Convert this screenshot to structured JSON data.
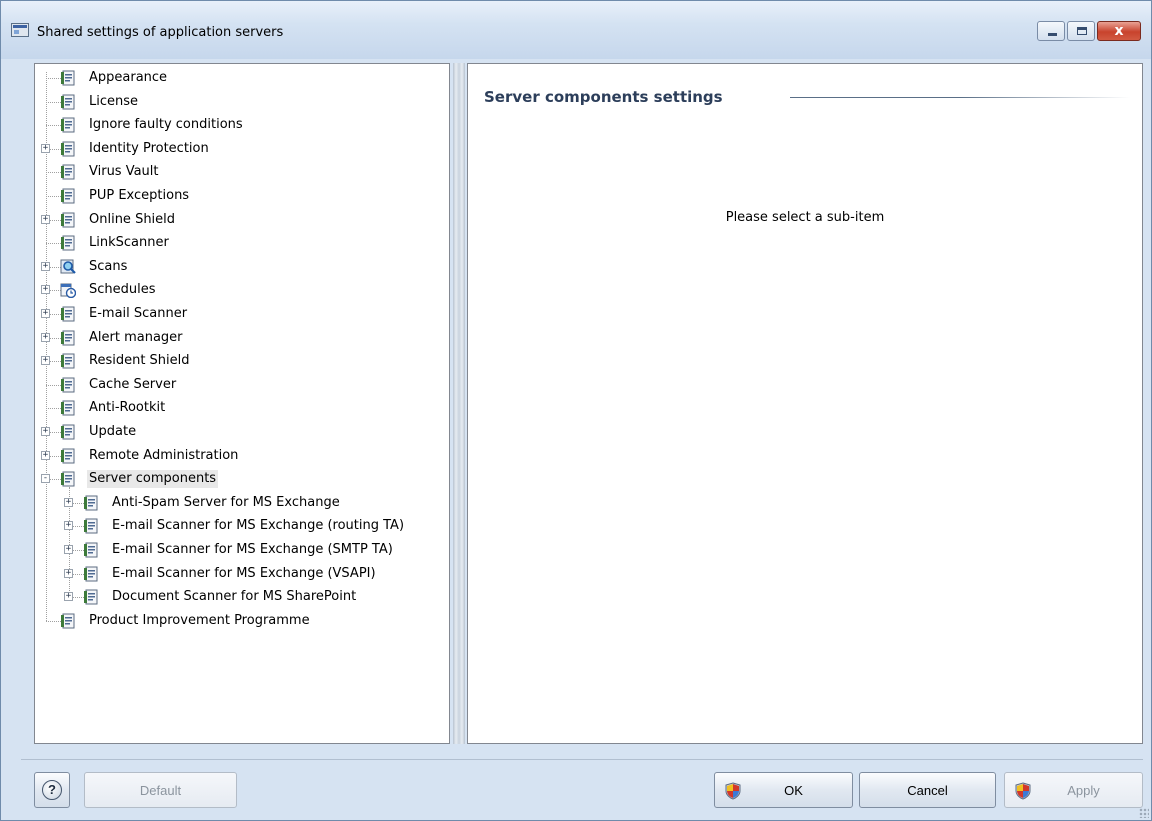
{
  "window": {
    "title": "Shared settings of application servers",
    "close_glyph": "x",
    "minimize_icon": "minimize-icon",
    "maximize_icon": "maximize-icon",
    "close_icon": "close-icon"
  },
  "tree": {
    "items": [
      {
        "label": "Appearance",
        "icon": "settings-page-icon",
        "expander": "",
        "level": 0
      },
      {
        "label": "License",
        "icon": "settings-page-icon",
        "expander": "",
        "level": 0
      },
      {
        "label": "Ignore faulty conditions",
        "icon": "settings-page-icon",
        "expander": "",
        "level": 0
      },
      {
        "label": "Identity Protection",
        "icon": "settings-page-icon",
        "expander": "+",
        "level": 0
      },
      {
        "label": "Virus Vault",
        "icon": "settings-page-icon",
        "expander": "",
        "level": 0
      },
      {
        "label": "PUP Exceptions",
        "icon": "settings-page-icon",
        "expander": "",
        "level": 0
      },
      {
        "label": "Online Shield",
        "icon": "settings-page-icon",
        "expander": "+",
        "level": 0
      },
      {
        "label": "LinkScanner",
        "icon": "settings-page-icon",
        "expander": "",
        "level": 0
      },
      {
        "label": "Scans",
        "icon": "scan-magnifier-icon",
        "expander": "+",
        "level": 0
      },
      {
        "label": "Schedules",
        "icon": "schedule-clock-icon",
        "expander": "+",
        "level": 0
      },
      {
        "label": "E-mail Scanner",
        "icon": "settings-page-icon",
        "expander": "+",
        "level": 0
      },
      {
        "label": "Alert manager",
        "icon": "settings-page-icon",
        "expander": "+",
        "level": 0
      },
      {
        "label": "Resident Shield",
        "icon": "settings-page-icon",
        "expander": "+",
        "level": 0
      },
      {
        "label": "Cache Server",
        "icon": "settings-page-icon",
        "expander": "",
        "level": 0
      },
      {
        "label": "Anti-Rootkit",
        "icon": "settings-page-icon",
        "expander": "",
        "level": 0
      },
      {
        "label": "Update",
        "icon": "settings-page-icon",
        "expander": "+",
        "level": 0
      },
      {
        "label": "Remote Administration",
        "icon": "settings-page-icon",
        "expander": "+",
        "level": 0
      },
      {
        "label": "Server components",
        "icon": "settings-page-icon",
        "expander": "-",
        "level": 0,
        "selected": true
      },
      {
        "label": "Anti-Spam Server for MS Exchange",
        "icon": "settings-page-icon",
        "expander": "+",
        "level": 1
      },
      {
        "label": "E-mail Scanner for MS Exchange (routing TA)",
        "icon": "settings-page-icon",
        "expander": "+",
        "level": 1
      },
      {
        "label": "E-mail Scanner for MS Exchange (SMTP TA)",
        "icon": "settings-page-icon",
        "expander": "+",
        "level": 1
      },
      {
        "label": "E-mail Scanner for MS Exchange (VSAPI)",
        "icon": "settings-page-icon",
        "expander": "+",
        "level": 1
      },
      {
        "label": "Document Scanner for MS SharePoint",
        "icon": "settings-page-icon",
        "expander": "+",
        "level": 1
      },
      {
        "label": "Product Improvement Programme",
        "icon": "settings-page-icon",
        "expander": "",
        "level": 0
      }
    ]
  },
  "content": {
    "title": "Server components settings",
    "message": "Please select a sub-item"
  },
  "footer": {
    "help_glyph": "?",
    "default_label": "Default",
    "ok_label": "OK",
    "cancel_label": "Cancel",
    "apply_label": "Apply",
    "shield_icon": "uac-shield-icon"
  },
  "colors": {
    "window_bg": "#d6e3f2",
    "panel_border": "#828790",
    "content_title": "#2c3e5a",
    "selection_bg": "#e8e8e8"
  }
}
